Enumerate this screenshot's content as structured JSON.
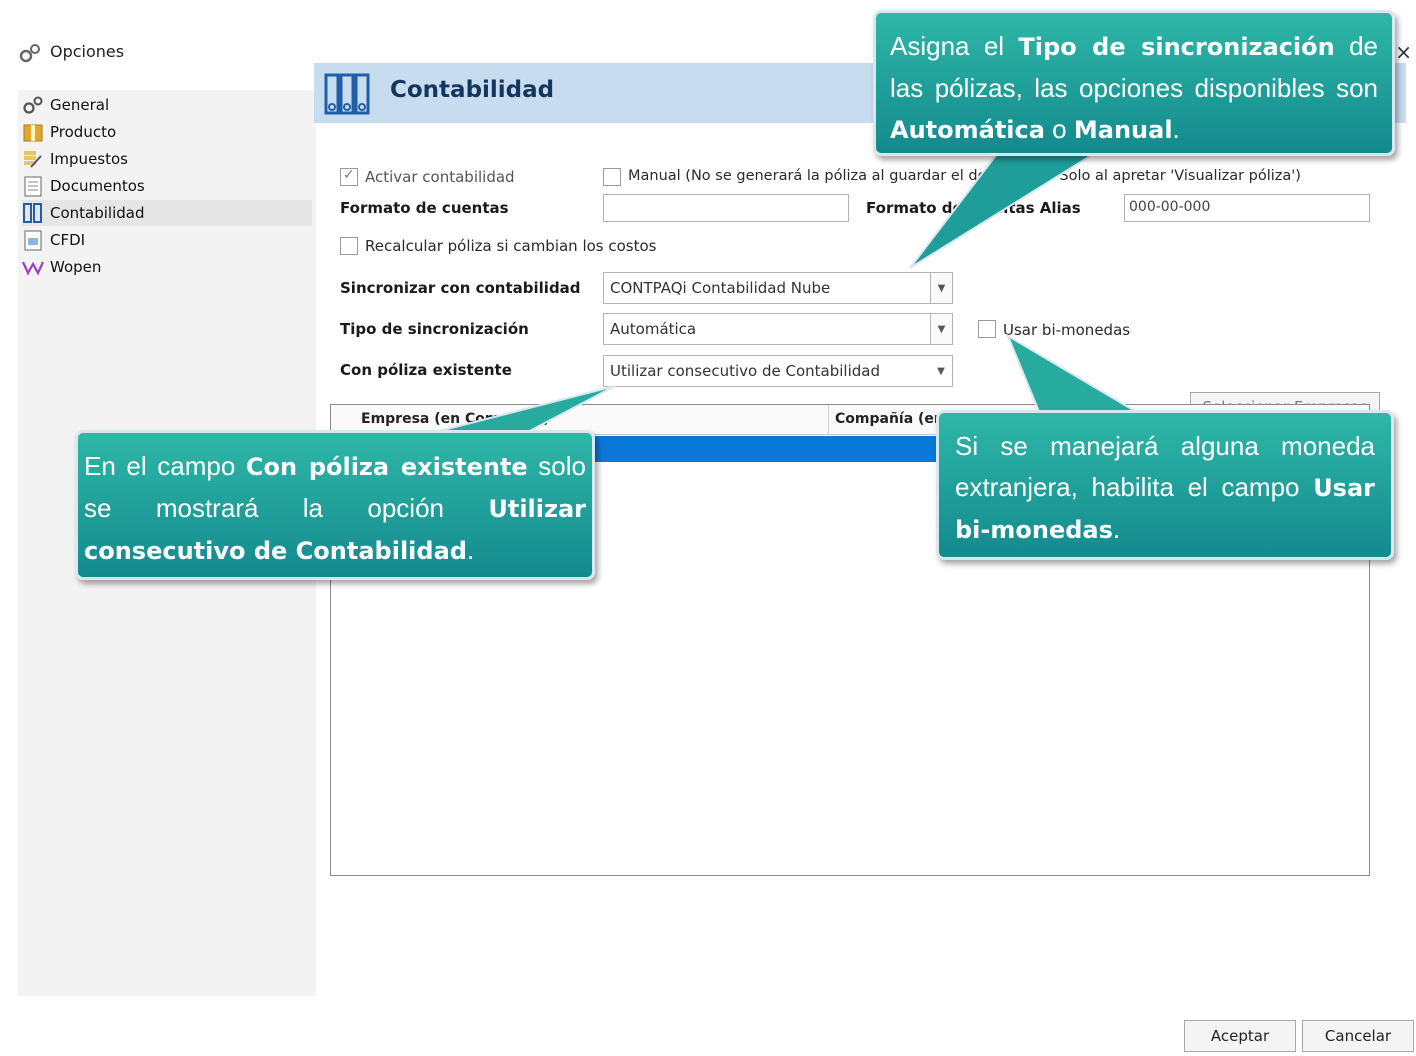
{
  "window": {
    "title": "Opciones",
    "close_label": "×"
  },
  "sidebar": {
    "items": [
      {
        "label": "General",
        "icon": "gears-icon"
      },
      {
        "label": "Producto",
        "icon": "product-icon"
      },
      {
        "label": "Impuestos",
        "icon": "taxes-icon"
      },
      {
        "label": "Documentos",
        "icon": "documents-icon"
      },
      {
        "label": "Contabilidad",
        "icon": "accounting-icon",
        "selected": true
      },
      {
        "label": "CFDI",
        "icon": "cfdi-icon"
      },
      {
        "label": "Wopen",
        "icon": "wopen-icon"
      }
    ]
  },
  "panel": {
    "title": "Contabilidad",
    "activar_label": "Activar contabilidad",
    "activar_checked": true,
    "manual_label": "Manual (No se generará la póliza al guardar el documento. Solo al apretar 'Visualizar póliza')",
    "manual_checked": false,
    "formato_cuentas_label": "Formato de cuentas",
    "formato_cuentas_value": "",
    "formato_alias_label": "Formato de cuentas Alias",
    "formato_alias_value": "000-00-000",
    "recalcular_label": "Recalcular póliza si cambian los costos",
    "sincronizar_label": "Sincronizar con contabilidad",
    "sincronizar_value": "CONTPAQi Contabilidad Nube",
    "tipo_label": "Tipo de sincronización",
    "tipo_value": "Automática",
    "bimonedas_label": "Usar bi-monedas",
    "poliza_label": "Con póliza existente",
    "poliza_value": "Utilizar consecutivo de Contabilidad",
    "seleccionar_label": "Seleccionar Empresas",
    "grid_columns": [
      "Empresa (en Comercial)",
      "Compañía (en Contabilidad)"
    ]
  },
  "footer": {
    "aceptar_label": "Aceptar",
    "cancelar_label": "Cancelar"
  },
  "callouts": {
    "tipo": {
      "t1": "Asigna el ",
      "b1": "Tipo de sincronización",
      "t2": " de las pólizas, las opciones disponibles son ",
      "b2": "Automática",
      "t3": " o ",
      "b3": "Manual",
      "t4": "."
    },
    "poliza": {
      "t1": "En el campo ",
      "b1": "Con póliza existente",
      "t2": " solo se mostrará la opción ",
      "b2": "Utilizar consecutivo de Contabilidad",
      "t3": "."
    },
    "bimonedas": {
      "t1": "Si se manejará alguna moneda extranjera, habilita el campo ",
      "b1": "Usar bi-monedas",
      "t2": "."
    }
  },
  "colors": {
    "callout_top": "#2fb7a7",
    "callout_bottom": "#138a8e",
    "header_band": "#c8dcf0",
    "selection": "#0a78d8"
  }
}
